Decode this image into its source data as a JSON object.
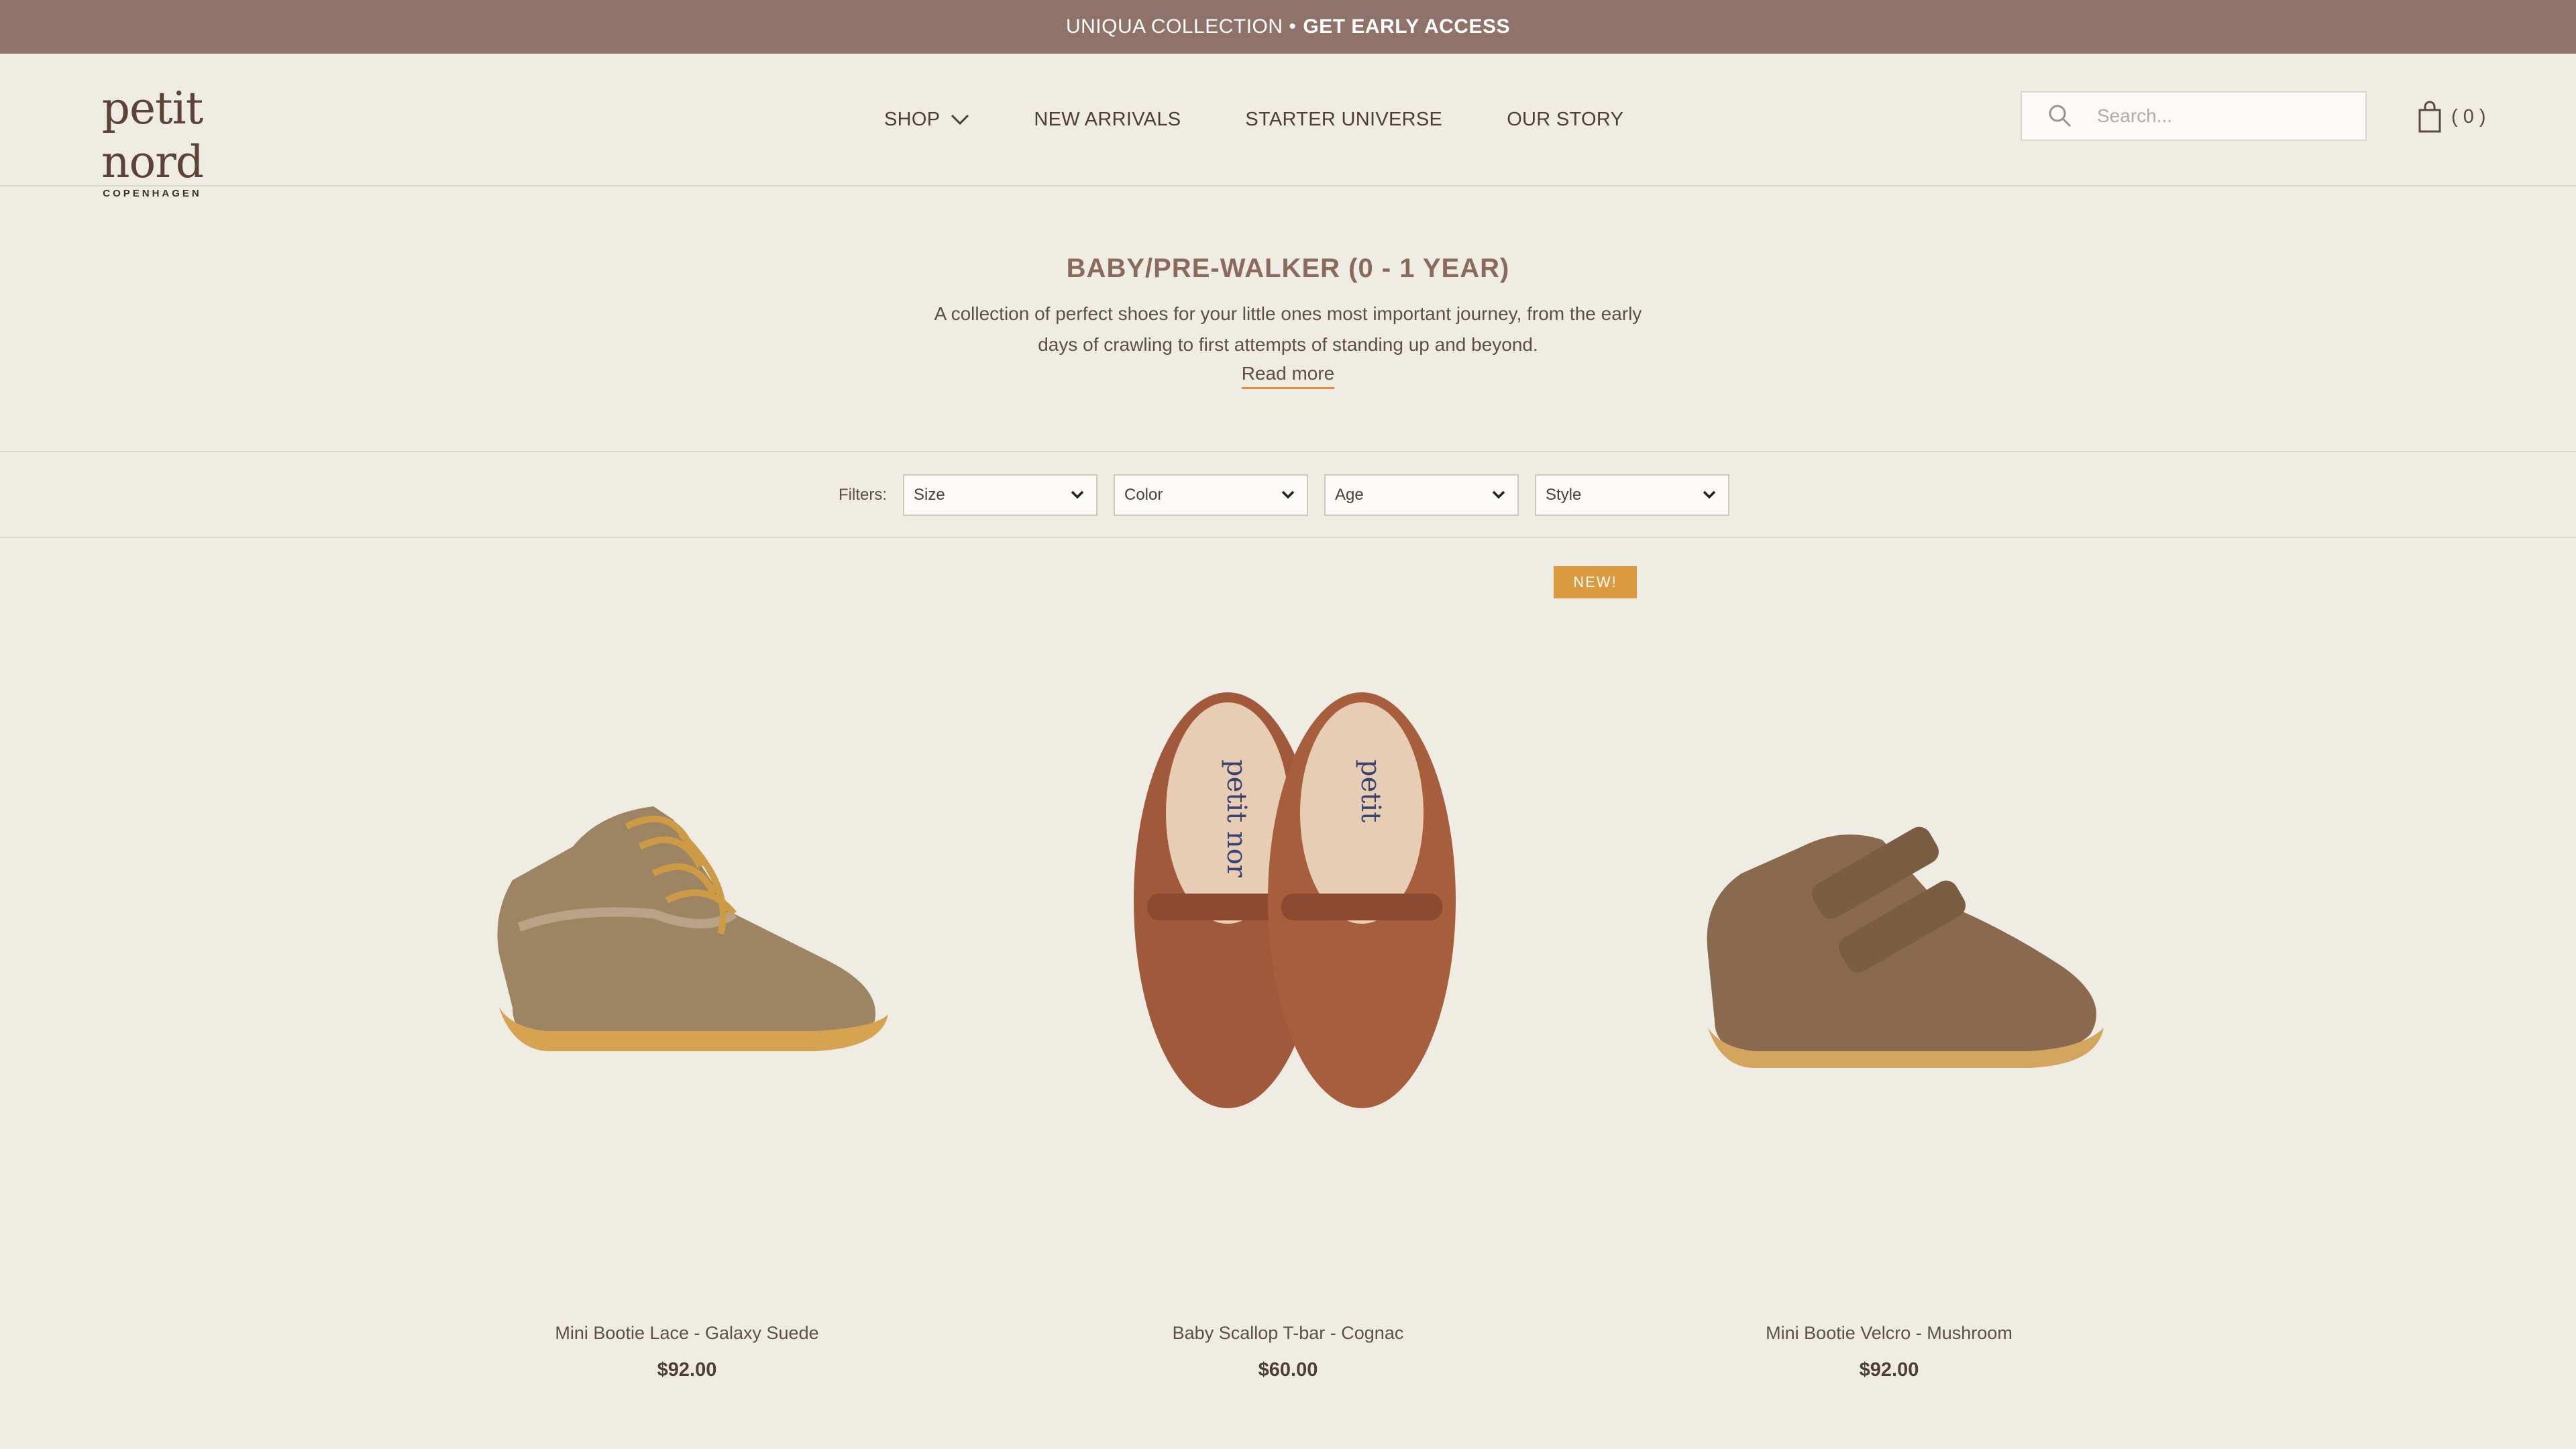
{
  "announcement": {
    "text": "UNIQUA COLLECTION •",
    "cta": "GET EARLY ACCESS"
  },
  "header": {
    "logo": {
      "main": "petit nord",
      "sub": "COPENHAGEN"
    },
    "nav": [
      {
        "label": "SHOP",
        "has_dropdown": true
      },
      {
        "label": "NEW ARRIVALS"
      },
      {
        "label": "STARTER UNIVERSE"
      },
      {
        "label": "OUR STORY"
      }
    ],
    "search": {
      "placeholder": "Search..."
    },
    "cart": {
      "count": "( 0 )"
    }
  },
  "collection": {
    "title": "BABY/PRE-WALKER (0 - 1 YEAR)",
    "description": "A collection of perfect shoes for your little ones most important journey, from the early days of crawling to first attempts of standing up and beyond.",
    "read_more": "Read more"
  },
  "filters": {
    "label": "Filters:",
    "selects": [
      "Size",
      "Color",
      "Age",
      "Style"
    ]
  },
  "products": [
    {
      "name": "Mini Bootie Lace - Galaxy Suede",
      "price": "$92.00",
      "badge": ""
    },
    {
      "name": "Baby Scallop T-bar - Cognac",
      "price": "$60.00",
      "badge": "NEW!"
    },
    {
      "name": "Mini Bootie Velcro - Mushroom",
      "price": "$92.00",
      "badge": ""
    }
  ],
  "colors": {
    "announcement_bg": "#8f7269",
    "page_bg": "#efece4",
    "title": "#8b6a5e",
    "badge": "#dc9a3e",
    "link_underline": "#e48a43"
  },
  "icons": {
    "search": "search-icon",
    "cart": "shopping-bag-icon",
    "dropdown": "chevron-down-icon"
  }
}
